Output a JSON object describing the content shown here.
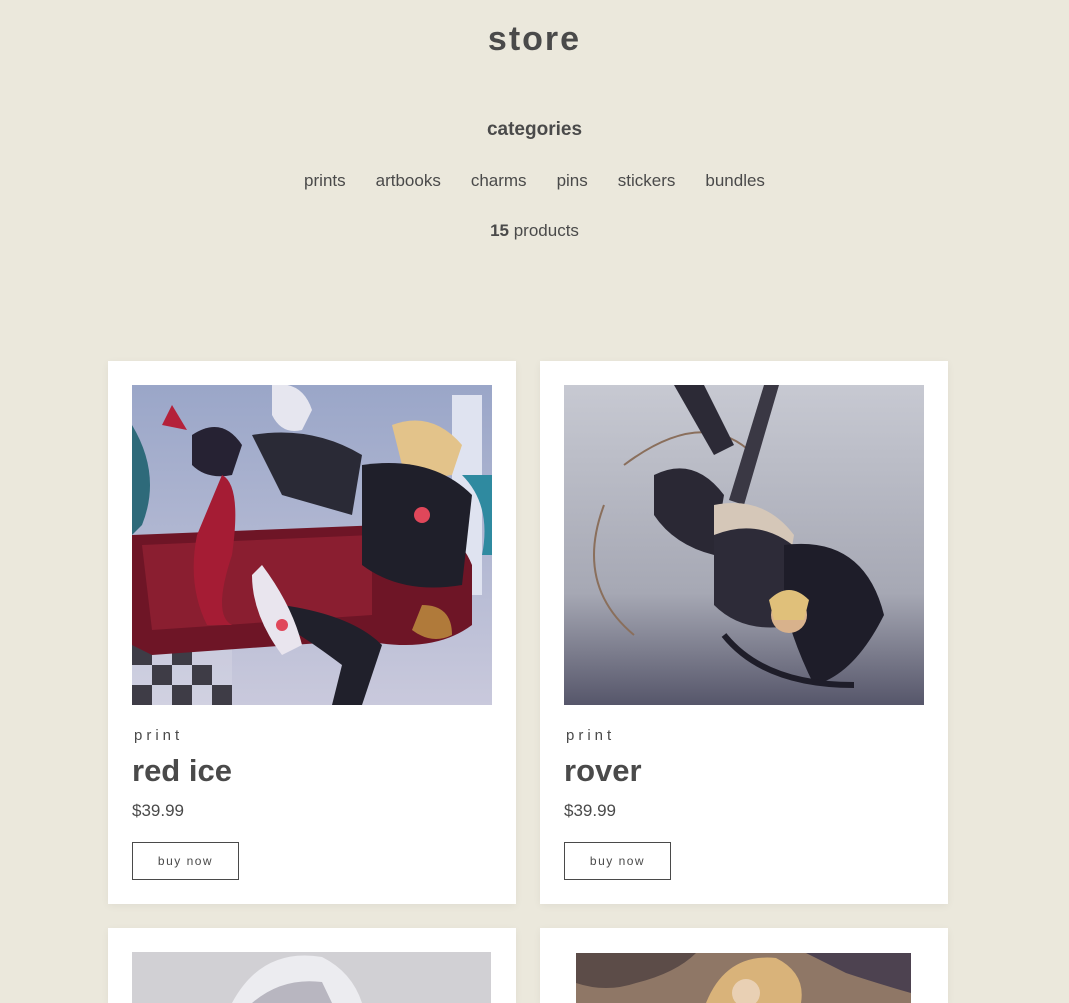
{
  "header": {
    "title": "store"
  },
  "categories": {
    "heading": "categories",
    "items": [
      "prints",
      "artbooks",
      "charms",
      "pins",
      "stickers",
      "bundles"
    ]
  },
  "product_count": {
    "number": "15",
    "label": "products"
  },
  "products": [
    {
      "type": "print",
      "name": "red ice",
      "price": "$39.99",
      "button": "buy now"
    },
    {
      "type": "print",
      "name": "rover",
      "price": "$39.99",
      "button": "buy now"
    }
  ],
  "colors": {
    "background": "#ebe8dc",
    "card": "#ffffff",
    "text": "#4a4a4a"
  }
}
